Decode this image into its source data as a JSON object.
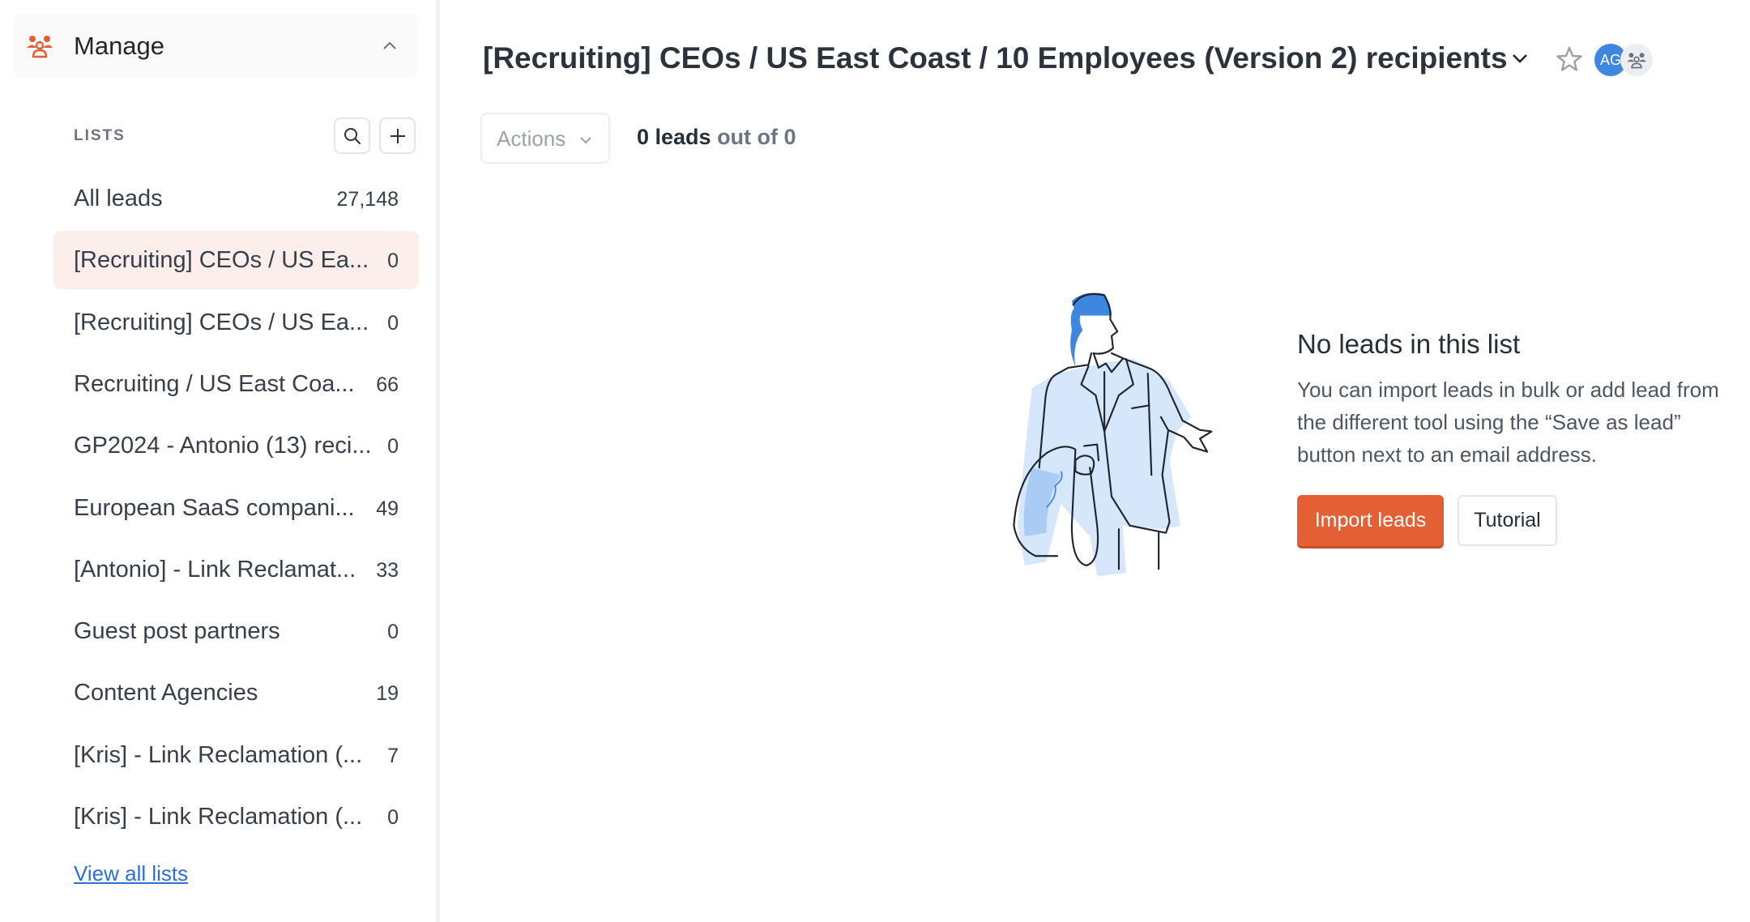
{
  "sidebar": {
    "section_title": "Manage",
    "section_icon": "people-group-icon",
    "lists_label": "LISTS",
    "search_icon": "search-icon",
    "add_icon": "plus-icon",
    "lists": [
      {
        "name": "All leads",
        "count": "27,148",
        "selected": false
      },
      {
        "name": "[Recruiting] CEOs / US Ea...",
        "count": "0",
        "selected": true
      },
      {
        "name": "[Recruiting] CEOs / US Ea...",
        "count": "0",
        "selected": false
      },
      {
        "name": "Recruiting / US East Coa...",
        "count": "66",
        "selected": false
      },
      {
        "name": "GP2024 - Antonio (13) reci...",
        "count": "0",
        "selected": false
      },
      {
        "name": "European SaaS compani...",
        "count": "49",
        "selected": false
      },
      {
        "name": "[Antonio] - Link Reclamat...",
        "count": "33",
        "selected": false
      },
      {
        "name": "Guest post partners",
        "count": "0",
        "selected": false
      },
      {
        "name": "Content Agencies",
        "count": "19",
        "selected": false
      },
      {
        "name": "[Kris] - Link Reclamation (...",
        "count": "7",
        "selected": false
      },
      {
        "name": "[Kris] - Link Reclamation (...",
        "count": "0",
        "selected": false
      }
    ],
    "view_all_label": "View all lists"
  },
  "header": {
    "title": "[Recruiting] CEOs / US East Coast / 10 Employees (Version 2) recipients",
    "avatar_initials": "AG"
  },
  "toolbar": {
    "actions_label": "Actions",
    "leads_count_bold": "0 leads",
    "leads_count_rest": " out of 0"
  },
  "empty_state": {
    "title": "No leads in this list",
    "description": "You can import leads in bulk or add lead from the different tool using the “Save as lead” button next to an email address.",
    "import_button": "Import leads",
    "tutorial_button": "Tutorial"
  },
  "colors": {
    "accent": "#e55f35",
    "selected_row_bg": "#fbeeeb",
    "link": "#2d6fd6",
    "avatar": "#3f86e0"
  }
}
